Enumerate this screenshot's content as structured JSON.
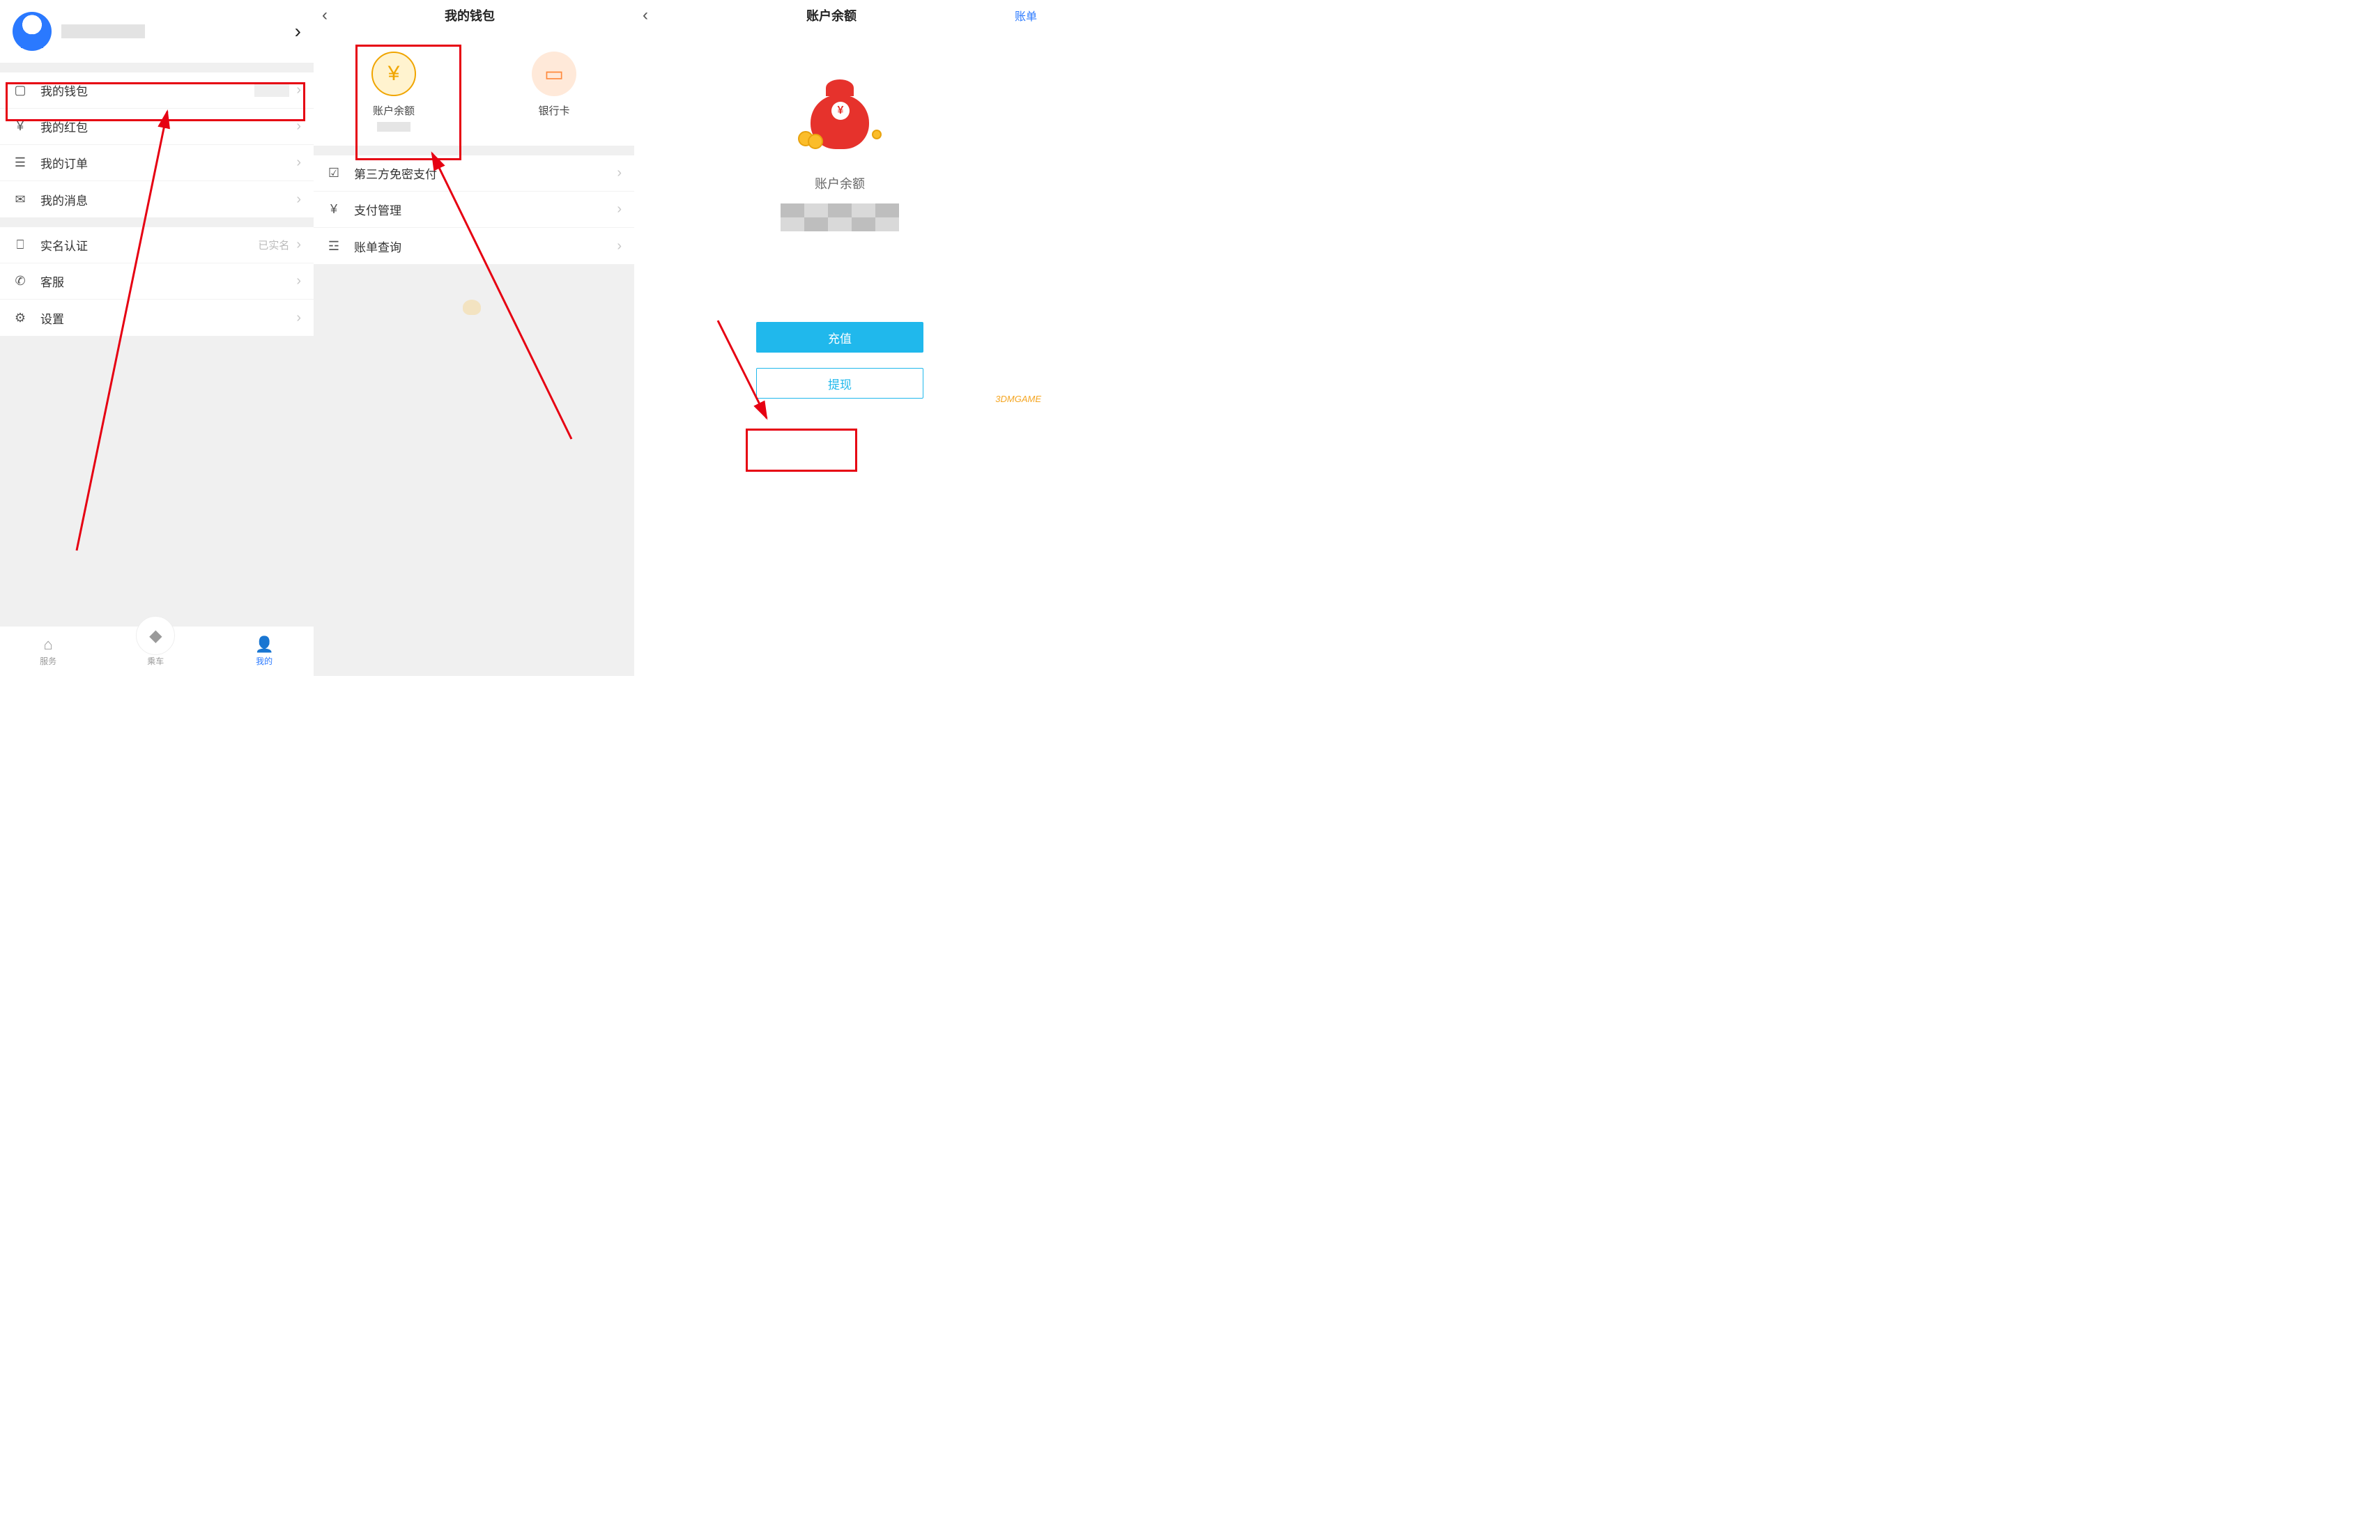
{
  "screen1": {
    "rows": {
      "wallet": "我的钱包",
      "redpacket": "我的红包",
      "orders": "我的订单",
      "messages": "我的消息",
      "realname": "实名认证",
      "realname_status": "已实名",
      "support": "客服",
      "settings": "设置"
    },
    "tabs": {
      "service": "服务",
      "ride": "乘车",
      "mine": "我的"
    }
  },
  "screen2": {
    "title": "我的钱包",
    "balance": "账户余额",
    "bankcard": "银行卡",
    "rows": {
      "thirdparty": "第三方免密支付",
      "paymgmt": "支付管理",
      "bills": "账单查询"
    }
  },
  "screen3": {
    "title": "账户余额",
    "rightlink": "账单",
    "balance_label": "账户余额",
    "recharge": "充值",
    "withdraw": "提现"
  },
  "watermark": "3DMGAME"
}
